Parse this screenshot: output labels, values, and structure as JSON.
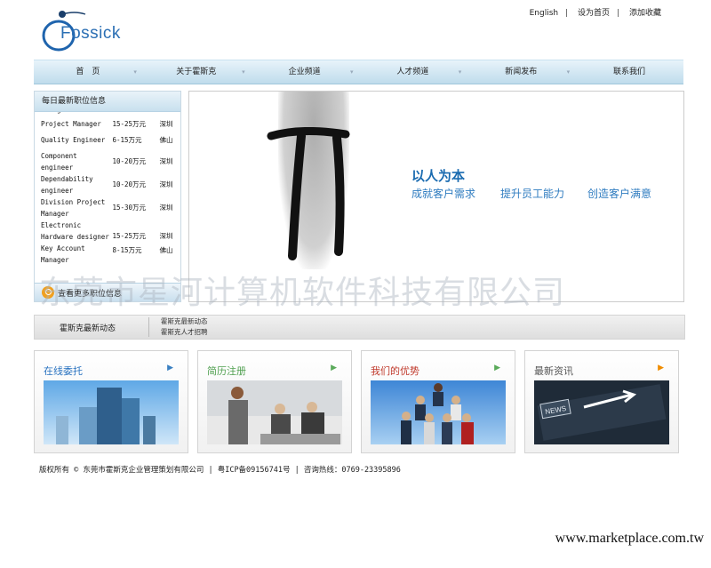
{
  "brand": {
    "name": "Fossick"
  },
  "top_links": [
    "English",
    "设为首页",
    "添加收藏"
  ],
  "nav": [
    "首　页",
    "关于霍斯克",
    "企业频道",
    "人才频道",
    "新闻发布",
    "联系我们"
  ],
  "jobs": {
    "title": "每日最新职位信息",
    "items": [
      {
        "title": "Manager",
        "salary": "",
        "location": ""
      },
      {
        "title": "Project Manager",
        "salary": "15-25万元",
        "location": "深圳"
      },
      {
        "title": "Quality Engineer",
        "salary": "6-15万元",
        "location": "佛山"
      },
      {
        "title": "Component engineer",
        "salary": "10-20万元",
        "location": "深圳"
      },
      {
        "title": "Dependability engineer",
        "salary": "10-20万元",
        "location": "深圳"
      },
      {
        "title": "Division Project Manager",
        "salary": "15-30万元",
        "location": "深圳"
      },
      {
        "title": "Electronic Hardware designer",
        "salary": "15-25万元",
        "location": "深圳"
      },
      {
        "title": "Key Account Manager",
        "salary": "8-15万元",
        "location": "佛山"
      }
    ],
    "footer_label": "查看更多职位信息"
  },
  "banner": {
    "slogan_main": "以人为本",
    "slogans": [
      "成就客户需求",
      "提升员工能力",
      "创造客户满意"
    ]
  },
  "watermark": "东莞市星河计算机软件科技有限公司",
  "news": {
    "label": "霍斯克最新动态",
    "items": [
      "霍斯克最新动态",
      "霍斯克人才招聘"
    ]
  },
  "cards": [
    {
      "title": "在线委托",
      "color": "#2a73c0",
      "arrow_color": "#3a80c2",
      "image": "buildings"
    },
    {
      "title": "简历注册",
      "color": "#50a050",
      "arrow_color": "#5aaa5a",
      "image": "handshake"
    },
    {
      "title": "我们的优势",
      "color": "#c0392b",
      "arrow_color": "#5aaa5a",
      "image": "team"
    },
    {
      "title": "最新资讯",
      "color": "#555555",
      "arrow_color": "#f08c00",
      "image": "news-sign"
    }
  ],
  "footer": {
    "text": "版权所有 © 东莞市霍斯克企业管理策划有限公司 | 粤ICP备09156741号 | 咨询热线：0769-23395896"
  },
  "site_mark": "www.marketplace.com.tw"
}
